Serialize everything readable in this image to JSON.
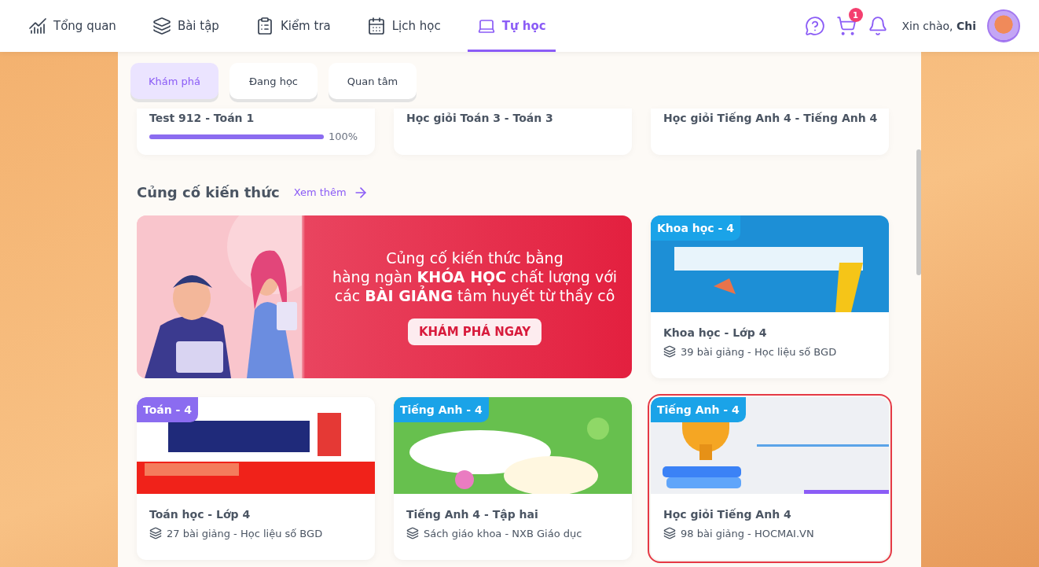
{
  "nav": {
    "items": [
      {
        "label": "Tổng quan",
        "kind": "chart",
        "selected": false
      },
      {
        "label": "Bài tập",
        "kind": "layers",
        "selected": false
      },
      {
        "label": "Kiểm tra",
        "kind": "test",
        "selected": false
      },
      {
        "label": "Lịch học",
        "kind": "calendar",
        "selected": false
      },
      {
        "label": "Tự học",
        "kind": "laptop",
        "selected": true
      }
    ],
    "cart_badge": "1",
    "greeting": "Xin chào, **Chi**"
  },
  "tabs": [
    {
      "label": "Khám phá",
      "selected": true
    },
    {
      "label": "Đang học",
      "selected": false
    },
    {
      "label": "Quan tâm",
      "selected": false
    }
  ],
  "in_progress": [
    {
      "title": "Test 912 - Toán 1",
      "level": 1,
      "reading": "100%"
    },
    {
      "title": "Học giỏi Toán 3 - Toán 3"
    },
    {
      "title": "Học giỏi Tiếng Anh 4 - Tiếng Anh 4"
    }
  ],
  "section": {
    "title": "Củng cố kiến thức",
    "link": "Xem thêm"
  },
  "banner": {
    "lines": [
      "Củng cố kiến thức bằng",
      "hàng ngàn **KHÓA HỌC** chất lượng với",
      "các **BÀI GIẢNG** tâm huyết từ thầy cô"
    ],
    "button": "KHÁM PHÁ NGAY"
  },
  "courses": [
    {
      "tag": "Khoa học - 4",
      "color": "#1aa3e8",
      "title": "Khoa học - Lớp 4",
      "meta": "39 bài giảng - Học liệu số BGD",
      "highlighted": false
    },
    {
      "tag": "Toán - 4",
      "color": "#8b6cf0",
      "title": "Toán học - Lớp 4",
      "meta": "27 bài giảng - Học liệu số BGD",
      "highlighted": false
    },
    {
      "tag": "Tiếng Anh - 4",
      "color": "#1aa3e8",
      "title": "Tiếng Anh 4 - Tập hai",
      "meta": "Sách giáo khoa - NXB Giáo dục",
      "highlighted": false
    },
    {
      "tag": "Tiếng Anh - 4",
      "color": "#1aa3e8",
      "title": "Học giỏi Tiếng Anh 4",
      "meta": "98 bài giảng - HOCMAI.VN",
      "highlighted": true
    }
  ]
}
